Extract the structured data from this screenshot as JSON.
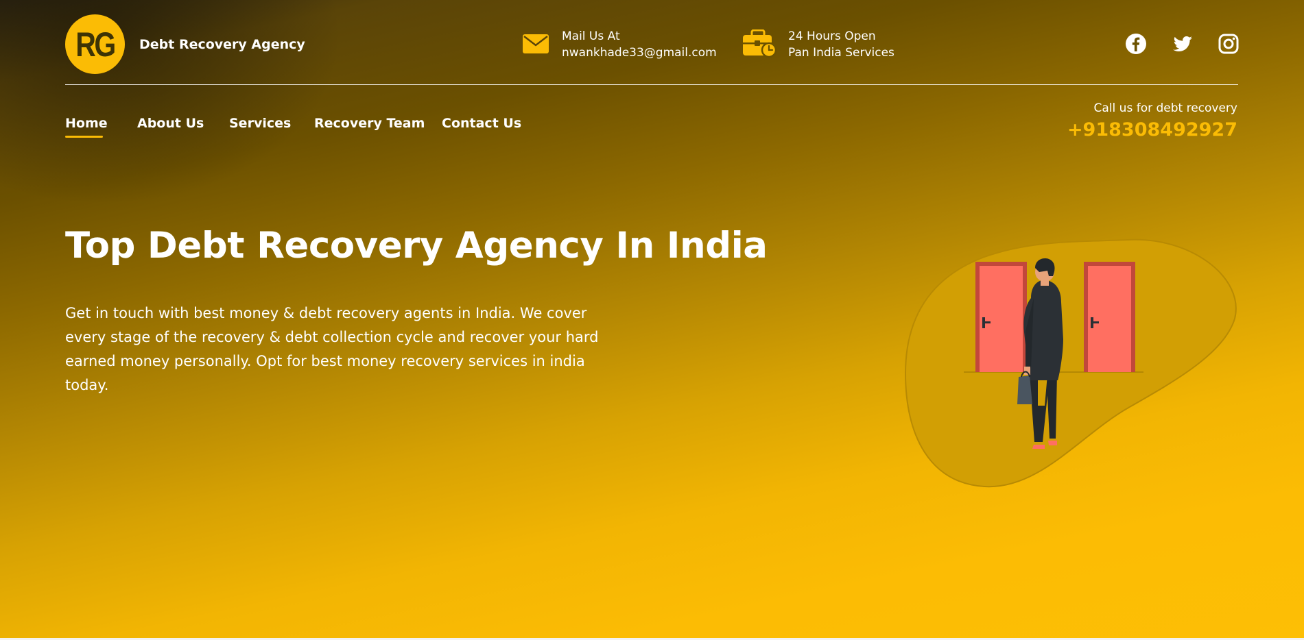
{
  "brand": {
    "logo_text": "RG",
    "name": "Debt Recovery Agency"
  },
  "contact_info": {
    "mail_label": "Mail Us At",
    "mail_value": "nwankhade33@gmail.com",
    "hours_label": "24 Hours Open",
    "hours_value": "Pan India Services"
  },
  "social": [
    "facebook-icon",
    "twitter-icon",
    "instagram-icon"
  ],
  "nav": {
    "items": [
      {
        "label": "Home",
        "active": true
      },
      {
        "label": "About Us"
      },
      {
        "label": "Services"
      },
      {
        "label": "Recovery Team"
      },
      {
        "label": "Contact Us"
      }
    ],
    "call_label": "Call us for debt recovery",
    "call_number": "+918308492927"
  },
  "hero": {
    "title": "Top Debt Recovery Agency In India",
    "subtitle": "Get in touch with best money & debt recovery agents in India. We cover every stage of the recovery & debt collection cycle and recover your hard earned money personally. Opt for best money recovery services in india today."
  },
  "colors": {
    "accent": "#fbbc05",
    "door": "#ff6f61",
    "suit": "#2b3035"
  }
}
